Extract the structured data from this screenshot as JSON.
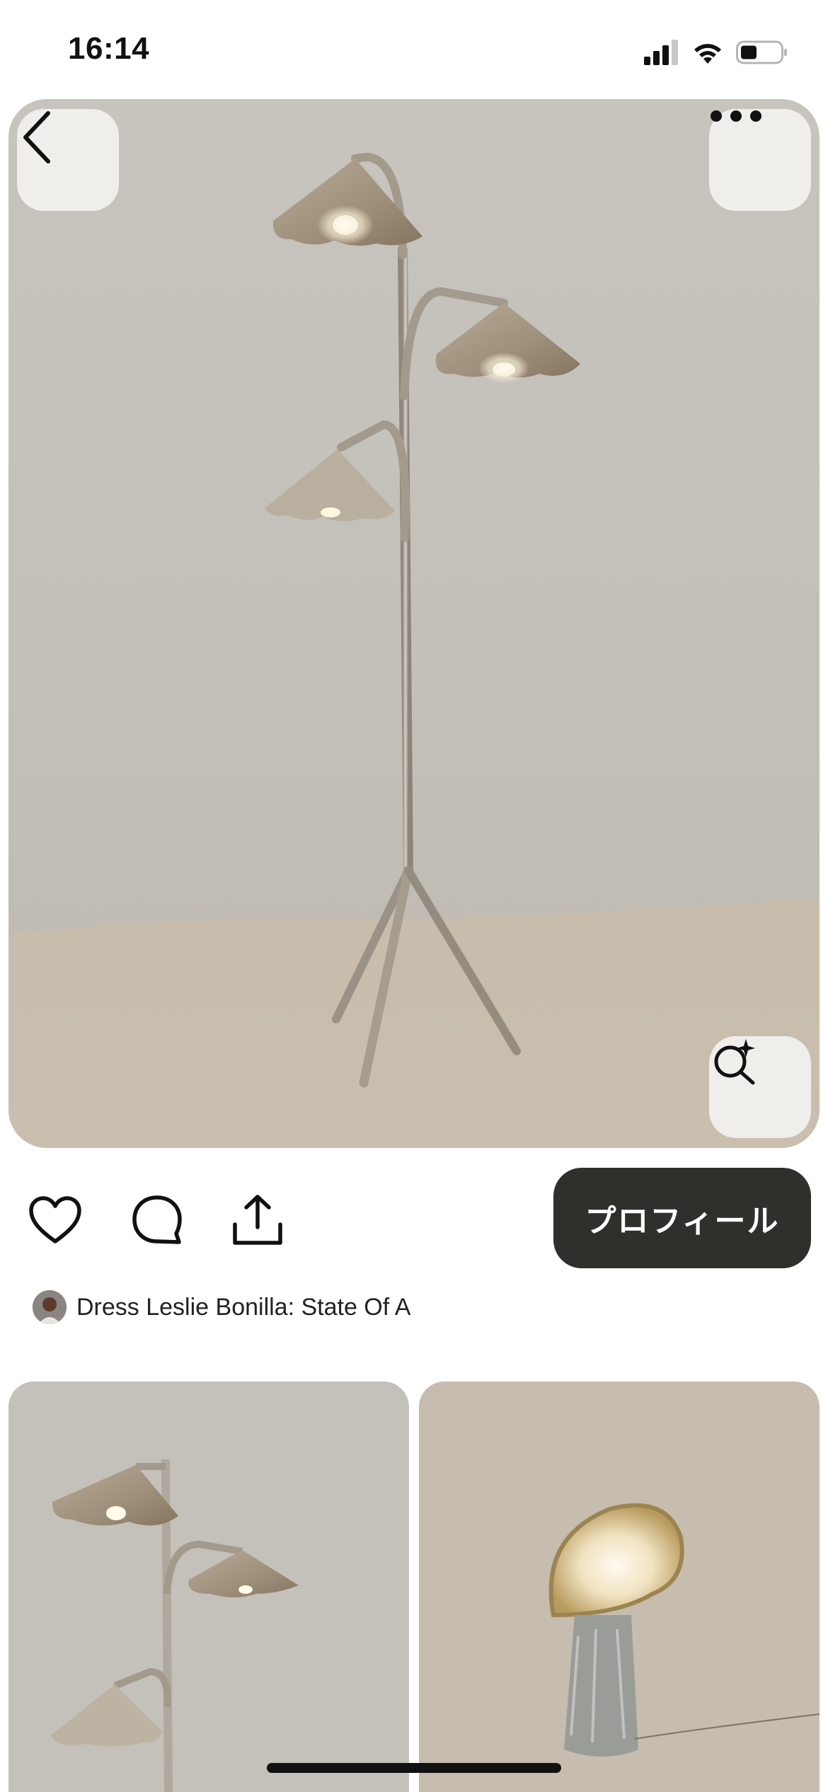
{
  "status_bar": {
    "time": "16:14"
  },
  "pin": {
    "actions": {
      "profile_label": "プロフィール"
    },
    "creator": {
      "name": "Dress Leslie Bonilla: State Of A"
    }
  },
  "icons": {
    "back": "chevron-left-icon",
    "more": "ellipsis-icon",
    "lens": "visual-search-icon",
    "like": "heart-icon",
    "comment": "comment-bubble-icon",
    "share": "share-upload-icon"
  },
  "colors": {
    "profile_button_bg": "#2f302c",
    "overlay_button_bg": "#efeeea"
  }
}
